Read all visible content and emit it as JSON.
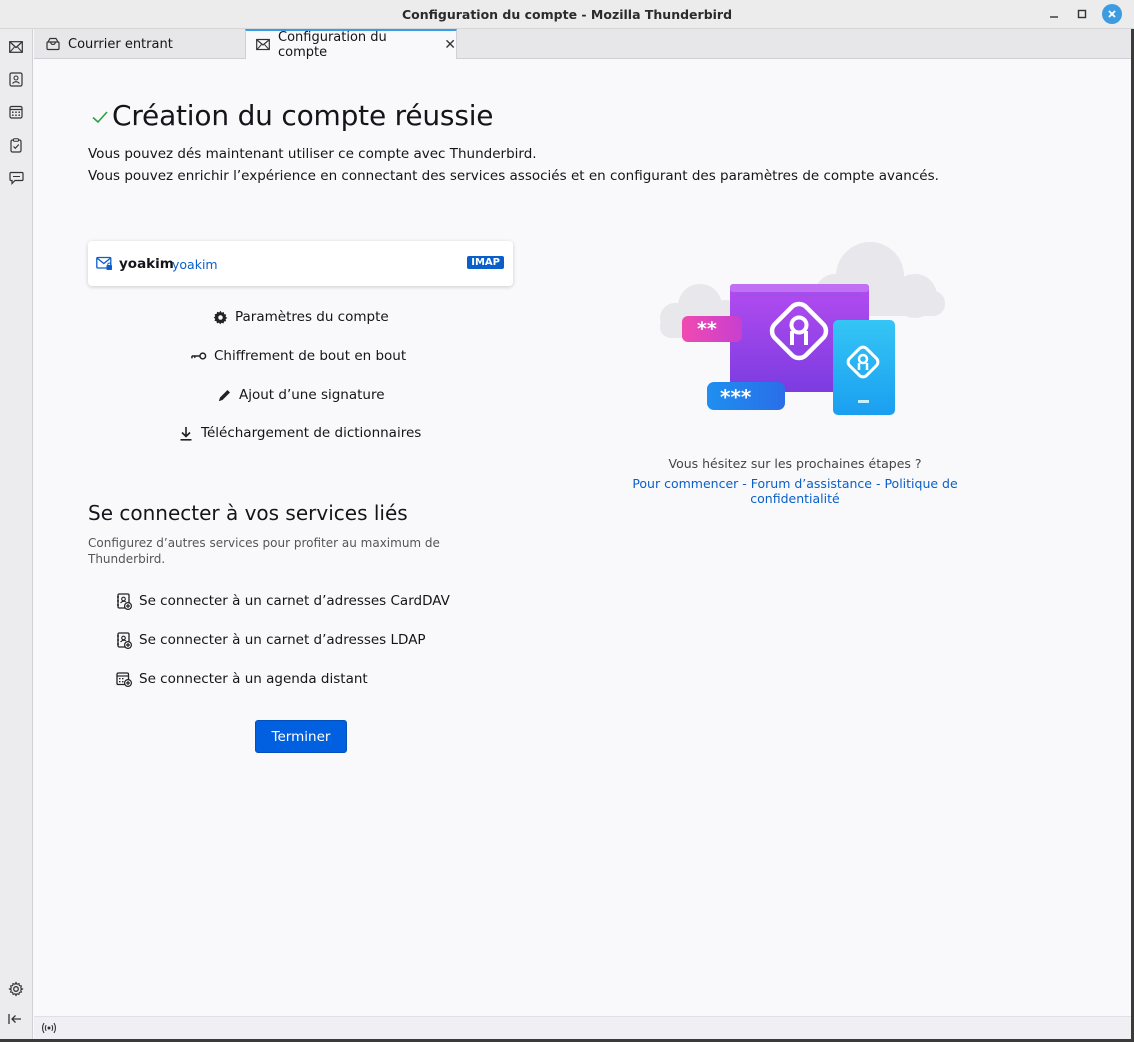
{
  "window": {
    "title": "Configuration du compte - Mozilla Thunderbird",
    "minimize_icon": "minimize-icon",
    "maximize_icon": "maximize-icon",
    "close_icon": "close-icon"
  },
  "tabs": [
    {
      "label": "Courrier entrant",
      "icon": "inbox-icon",
      "active": false
    },
    {
      "label": "Configuration du compte",
      "icon": "account-setup-icon",
      "active": true,
      "close": "✕"
    }
  ],
  "spaces": [
    "mail-icon",
    "address-book-icon",
    "calendar-icon",
    "tasks-icon",
    "chat-icon"
  ],
  "main": {
    "title": "Création du compte réussie",
    "line1": "Vous pouvez dés maintenant utiliser ce compte avec Thunderbird.",
    "line2": "Vous pouvez enrichir l’expérience en connectant des services associés et en configurant des paramètres de compte avancés.",
    "account": {
      "name": "yoakim",
      "email": "yoakim",
      "protocol": "IMAP"
    },
    "actions": [
      {
        "label": "Paramètres du compte",
        "icon": "gear-icon"
      },
      {
        "label": "Chiffrement de bout en bout",
        "icon": "key-icon"
      },
      {
        "label": "Ajout d’une signature",
        "icon": "pencil-icon"
      },
      {
        "label": "Téléchargement de dictionnaires",
        "icon": "download-icon"
      }
    ],
    "services_title": "Se connecter à vos services liés",
    "services_desc": "Configurez d’autres services pour profiter au maximum de Thunderbird.",
    "services": [
      {
        "label": "Se connecter à un carnet d’adresses CardDAV",
        "icon": "address-book-add-icon"
      },
      {
        "label": "Se connecter à un carnet d’adresses LDAP",
        "icon": "address-book-add-icon"
      },
      {
        "label": "Se connecter à un agenda distant",
        "icon": "calendar-add-icon"
      }
    ],
    "finish_button": "Terminer",
    "help_question": "Vous hésitez sur les prochaines étapes ?",
    "help_links": {
      "start": "Pour commencer",
      "sep1": " - ",
      "forum": "Forum d’assistance",
      "sep2": " - ",
      "privacy": "Politique de confidentialité"
    }
  },
  "colors": {
    "accent": "#0060df",
    "link": "#0a5fc9",
    "check": "#2ea043"
  }
}
